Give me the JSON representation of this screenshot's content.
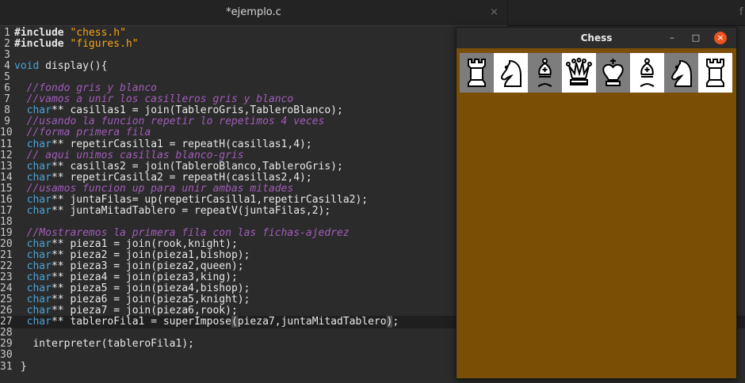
{
  "tabs": {
    "active_title": "*ejemplo.c",
    "close_glyph": "×",
    "second_title": "f"
  },
  "code_lines": [
    {
      "n": "1",
      "parts": [
        {
          "t": "#include ",
          "c": "pp"
        },
        {
          "t": "\"chess.h\"",
          "c": "st"
        }
      ]
    },
    {
      "n": "2",
      "parts": [
        {
          "t": "#include ",
          "c": "pp"
        },
        {
          "t": "\"figures.h\"",
          "c": "st"
        }
      ]
    },
    {
      "n": "3",
      "parts": []
    },
    {
      "n": "4",
      "parts": [
        {
          "t": "void",
          "c": "kw"
        },
        {
          "t": " display(){",
          "c": ""
        }
      ]
    },
    {
      "n": "5",
      "parts": []
    },
    {
      "n": "6",
      "parts": [
        {
          "t": "  //fondo gris y blanco",
          "c": "cm"
        }
      ]
    },
    {
      "n": "7",
      "parts": [
        {
          "t": "  //vamos a unir los casilleros gris y blanco",
          "c": "cm"
        }
      ]
    },
    {
      "n": "8",
      "parts": [
        {
          "t": "  ",
          "c": ""
        },
        {
          "t": "char",
          "c": "kw"
        },
        {
          "t": "** casillas1 = join(TableroGris,TableroBlanco);",
          "c": ""
        }
      ]
    },
    {
      "n": "9",
      "parts": [
        {
          "t": "  //usando la funcion repetir lo repetimos 4 veces",
          "c": "cm"
        }
      ]
    },
    {
      "n": "10",
      "parts": [
        {
          "t": "  //forma primera fila",
          "c": "cm"
        }
      ]
    },
    {
      "n": "11",
      "parts": [
        {
          "t": "  ",
          "c": ""
        },
        {
          "t": "char",
          "c": "kw"
        },
        {
          "t": "** repetirCasilla1 = repeatH(casillas1,4);",
          "c": ""
        }
      ]
    },
    {
      "n": "12",
      "parts": [
        {
          "t": "  // aqui unimos casillas blanco-gris",
          "c": "cm"
        }
      ]
    },
    {
      "n": "13",
      "parts": [
        {
          "t": "  ",
          "c": ""
        },
        {
          "t": "char",
          "c": "kw"
        },
        {
          "t": "** casillas2 = join(TableroBlanco,TableroGris);",
          "c": ""
        }
      ]
    },
    {
      "n": "14",
      "parts": [
        {
          "t": "  ",
          "c": ""
        },
        {
          "t": "char",
          "c": "kw"
        },
        {
          "t": "** repetirCasilla2 = repeatH(casillas2,4);",
          "c": ""
        }
      ]
    },
    {
      "n": "15",
      "parts": [
        {
          "t": "  //usamos funcion up para unir ambas mitades",
          "c": "cm"
        }
      ]
    },
    {
      "n": "16",
      "parts": [
        {
          "t": "  ",
          "c": ""
        },
        {
          "t": "char",
          "c": "kw"
        },
        {
          "t": "** juntaFilas= up(repetirCasilla1,repetirCasilla2);",
          "c": ""
        }
      ]
    },
    {
      "n": "17",
      "parts": [
        {
          "t": "  ",
          "c": ""
        },
        {
          "t": "char",
          "c": "kw"
        },
        {
          "t": "** juntaMitadTablero = repeatV(juntaFilas,2);",
          "c": ""
        }
      ]
    },
    {
      "n": "18",
      "parts": []
    },
    {
      "n": "19",
      "parts": [
        {
          "t": "  //Mostraremos la primera fila con las fichas-ajedrez",
          "c": "cm"
        }
      ]
    },
    {
      "n": "20",
      "parts": [
        {
          "t": "  ",
          "c": ""
        },
        {
          "t": "char",
          "c": "kw"
        },
        {
          "t": "** pieza1 = join(rook,knight);",
          "c": ""
        }
      ]
    },
    {
      "n": "21",
      "parts": [
        {
          "t": "  ",
          "c": ""
        },
        {
          "t": "char",
          "c": "kw"
        },
        {
          "t": "** pieza2 = join(pieza1,bishop);",
          "c": ""
        }
      ]
    },
    {
      "n": "22",
      "parts": [
        {
          "t": "  ",
          "c": ""
        },
        {
          "t": "char",
          "c": "kw"
        },
        {
          "t": "** pieza3 = join(pieza2,queen);",
          "c": ""
        }
      ]
    },
    {
      "n": "23",
      "parts": [
        {
          "t": "  ",
          "c": ""
        },
        {
          "t": "char",
          "c": "kw"
        },
        {
          "t": "** pieza4 = join(pieza3,king);",
          "c": ""
        }
      ]
    },
    {
      "n": "24",
      "parts": [
        {
          "t": "  ",
          "c": ""
        },
        {
          "t": "char",
          "c": "kw"
        },
        {
          "t": "** pieza5 = join(pieza4,bishop);",
          "c": ""
        }
      ]
    },
    {
      "n": "25",
      "parts": [
        {
          "t": "  ",
          "c": ""
        },
        {
          "t": "char",
          "c": "kw"
        },
        {
          "t": "** pieza6 = join(pieza5,knight);",
          "c": ""
        }
      ]
    },
    {
      "n": "26",
      "parts": [
        {
          "t": "  ",
          "c": ""
        },
        {
          "t": "char",
          "c": "kw"
        },
        {
          "t": "** pieza7 = join(pieza6,rook);",
          "c": ""
        }
      ]
    },
    {
      "n": "27",
      "current": true,
      "parts": [
        {
          "t": "  ",
          "c": ""
        },
        {
          "t": "char",
          "c": "kw"
        },
        {
          "t": "** tableroFila1 = superImpose",
          "c": ""
        },
        {
          "t": "(",
          "c": "hl"
        },
        {
          "t": "pieza7,juntaMitadTablero",
          "c": ""
        },
        {
          "t": ")",
          "c": "hl"
        },
        {
          "t": ";",
          "c": ""
        }
      ]
    },
    {
      "n": "28",
      "parts": []
    },
    {
      "n": "29",
      "parts": [
        {
          "t": "   interpreter(tableroFila1);",
          "c": ""
        }
      ]
    },
    {
      "n": "30",
      "parts": []
    },
    {
      "n": "31",
      "parts": [
        {
          "t": " }",
          "c": ""
        }
      ]
    }
  ],
  "chess_window": {
    "title": "Chess",
    "minimize": "–",
    "maximize": "□",
    "close": "×",
    "background": "#7a4f05",
    "squares": [
      {
        "shade": "dark",
        "piece": "rook"
      },
      {
        "shade": "light",
        "piece": "knight"
      },
      {
        "shade": "dark",
        "piece": "bishop"
      },
      {
        "shade": "light",
        "piece": "queen"
      },
      {
        "shade": "dark",
        "piece": "king"
      },
      {
        "shade": "light",
        "piece": "bishop"
      },
      {
        "shade": "dark",
        "piece": "knight"
      },
      {
        "shade": "light",
        "piece": "rook"
      }
    ]
  },
  "colors": {
    "editor_bg": "#2b2b2b",
    "comment": "#a15db8",
    "string": "#f5a417",
    "keyword": "#4ca3d9",
    "close_button": "#e95420"
  }
}
